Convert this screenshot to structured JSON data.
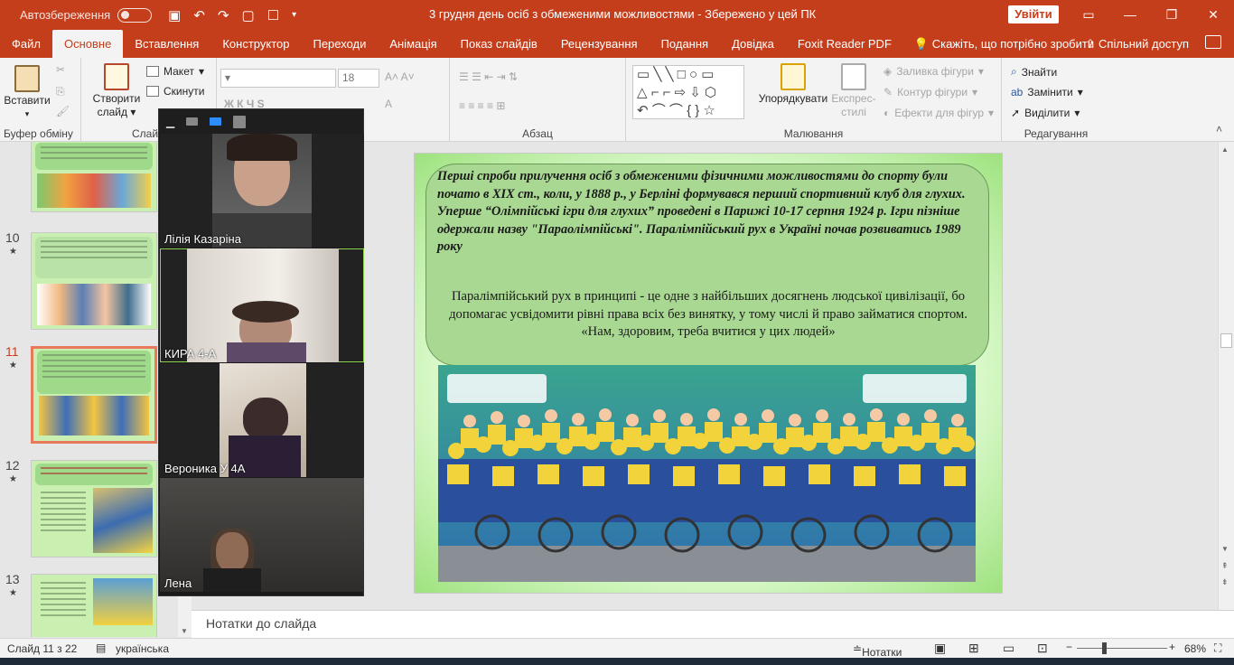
{
  "titlebar": {
    "autosave_label": "Автозбереження",
    "doc_title": "3 грудня день осіб з обмеженими можливостями  -  Збережено у цей ПК",
    "signin_label": "Увійти"
  },
  "tabs": [
    {
      "label": "Файл"
    },
    {
      "label": "Основне"
    },
    {
      "label": "Вставлення"
    },
    {
      "label": "Конструктор"
    },
    {
      "label": "Переходи"
    },
    {
      "label": "Анімація"
    },
    {
      "label": "Показ слайдів"
    },
    {
      "label": "Рецензування"
    },
    {
      "label": "Подання"
    },
    {
      "label": "Довідка"
    },
    {
      "label": "Foxit Reader PDF"
    }
  ],
  "tell_me": "Скажіть, що потрібно зробити",
  "share_label": "Спільний доступ",
  "ribbon": {
    "paste": "Вставити",
    "clipboard": "Буфер обміну",
    "new_slide_1": "Створити",
    "new_slide_2": "слайд",
    "layout": "Макет",
    "reset": "Скинути",
    "slides_group": "Слай",
    "font_size": "18",
    "paragraph": "Абзац",
    "arrange": "Упорядкувати",
    "quick_styles_1": "Експрес-",
    "quick_styles_2": "стилі",
    "shape_fill": "Заливка фігури",
    "shape_outline": "Контур фігури",
    "shape_effects": "Ефекти для фігур",
    "drawing": "Малювання",
    "find": "Знайти",
    "replace": "Замінити",
    "select": "Виділити",
    "editing": "Редагування"
  },
  "thumbs": [
    {
      "num": "10"
    },
    {
      "num": "11"
    },
    {
      "num": "12"
    },
    {
      "num": "13"
    }
  ],
  "zoom": {
    "participants": [
      {
        "name": "Лілія Казаріна"
      },
      {
        "name": "КИРА 4-А"
      },
      {
        "name": "Вероника У 4А"
      },
      {
        "name": "Лена"
      }
    ]
  },
  "slide": {
    "italic_text": "Перші спроби прилучення осіб  з обмеженими фізичними можливостями до спорту були почато в XIX ст., коли, у 1888 р., у Берліні формувався перший спортивний клуб для глухих. Уперше “Олімпійські ігри для глухих” проведені в Парижі  10-17 серпня 1924 р. Ігри пізніше одержали назву \"Параолімпійські\". Паралімпійський рух в Україні почав розвиватись 1989 року",
    "normal_text": "Паралімпійський рух в принципі - це одне з найбільших досягнень людської цивілізації, бо допомагає усвідомити рівні права всіх без винятку, у тому числі й право займатися спортом. «Нам, здоровим, треба вчитися у цих людей»"
  },
  "notes_placeholder": "Нотатки до слайда",
  "status": {
    "slide_info": "Слайд 11 з 22",
    "language": "українська",
    "notes": "Нотатки",
    "zoom": "68%"
  }
}
